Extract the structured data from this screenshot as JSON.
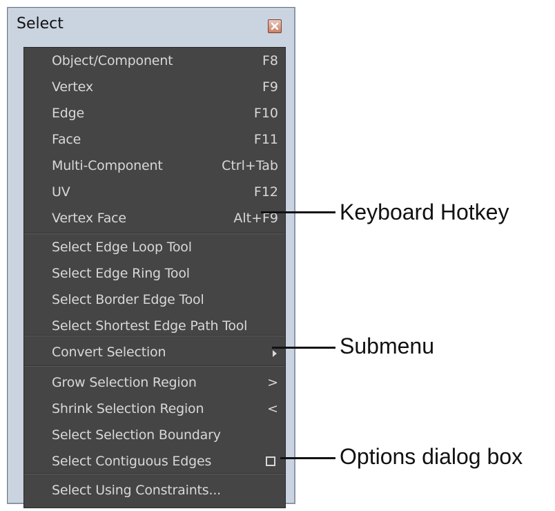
{
  "window": {
    "title": "Select"
  },
  "menu": {
    "items": [
      {
        "label": "Object/Component",
        "hotkey": "F8"
      },
      {
        "label": "Vertex",
        "hotkey": "F9"
      },
      {
        "label": "Edge",
        "hotkey": "F10"
      },
      {
        "label": "Face",
        "hotkey": "F11"
      },
      {
        "label": "Multi-Component",
        "hotkey": "Ctrl+Tab"
      },
      {
        "label": "UV",
        "hotkey": "F12"
      },
      {
        "label": "Vertex Face",
        "hotkey": "Alt+F9"
      },
      {
        "label": "Select Edge Loop Tool"
      },
      {
        "label": "Select Edge Ring Tool"
      },
      {
        "label": "Select Border Edge Tool"
      },
      {
        "label": "Select Shortest Edge Path Tool"
      },
      {
        "label": "Convert Selection"
      },
      {
        "label": "Grow Selection Region",
        "hotkey": ">"
      },
      {
        "label": "Shrink Selection Region",
        "hotkey": "<"
      },
      {
        "label": "Select Selection Boundary"
      },
      {
        "label": "Select Contiguous Edges"
      },
      {
        "label": "Select Using Constraints..."
      }
    ]
  },
  "callouts": {
    "hotkey": "Keyboard Hotkey",
    "submenu": "Submenu",
    "options": "Options dialog box"
  },
  "icons": {
    "close": "close-icon",
    "submenu": "submenu-arrow-icon",
    "options": "option-box-icon"
  },
  "colors": {
    "menu_bg": "#454545",
    "menu_text": "#d8d8d8",
    "window_bg": "#cad3e0"
  }
}
